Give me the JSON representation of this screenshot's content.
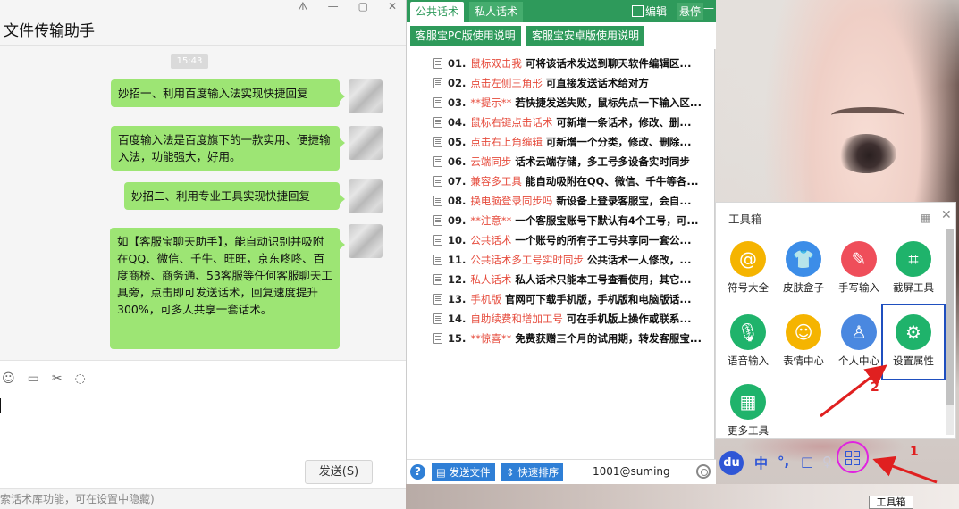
{
  "chat": {
    "title": "文件传输助手",
    "window_controls": [
      "ᗑ",
      "—",
      "▢",
      "✕"
    ],
    "time": "15:43",
    "messages": [
      "妙招一、利用百度输入法实现快捷回复",
      "百度输入法是百度旗下的一款实用、便捷输入法，功能强大，好用。",
      "妙招二、利用专业工具实现快捷回复",
      "如【客服宝聊天助手】，能自动识别并吸附在QQ、微信、千牛、旺旺，京东咚咚、百度商桥、商务通、53客服等任何客服聊天工具旁，点击即可发送话术，回复速度提升300%，可多人共享一套话术。"
    ],
    "input_icons": [
      "emoji-icon",
      "folder-icon",
      "scissors-icon",
      "chat-history-icon"
    ],
    "input_icon_glyphs": [
      "☺",
      "▭",
      "✂",
      "◌"
    ],
    "send_label": "发送(S)",
    "status_line": "索话术库功能，可在设置中隐藏)"
  },
  "panel": {
    "tabs": [
      "公共话术",
      "私人话术"
    ],
    "edit_label": "编辑",
    "pin_label": "悬停",
    "minimize_label": "—",
    "sub_tabs": [
      "客服宝PC版使用说明",
      "客服宝安卓版使用说明"
    ],
    "items": [
      {
        "num": "01.",
        "hl": "鼠标双击我",
        "text": "可将该话术发送到聊天软件编辑区..."
      },
      {
        "num": "02.",
        "hl": "点击左侧三角形",
        "text": "可直接发送话术给对方"
      },
      {
        "num": "03.",
        "hl": "**提示**",
        "text": "若快捷发送失败，鼠标先点一下输入区..."
      },
      {
        "num": "04.",
        "hl": "鼠标右键点击话术",
        "text": "可新增一条话术，修改、删..."
      },
      {
        "num": "05.",
        "hl": "点击右上角编辑",
        "text": "可新增一个分类，修改、删除..."
      },
      {
        "num": "06.",
        "hl": "云端同步",
        "text": "话术云端存储，多工号多设备实时同步"
      },
      {
        "num": "07.",
        "hl": "兼容多工具",
        "text": "能自动吸附在QQ、微信、千牛等各..."
      },
      {
        "num": "08.",
        "hl": "换电脑登录同步吗",
        "text": "新设备上登录客服宝，会自..."
      },
      {
        "num": "09.",
        "hl": "**注意**",
        "text": "一个客服宝账号下默认有4个工号，可..."
      },
      {
        "num": "10.",
        "hl": "公共话术",
        "text": "一个账号的所有子工号共享同一套公..."
      },
      {
        "num": "11.",
        "hl": "公共话术多工号实时同步",
        "text": "公共话术一人修改，..."
      },
      {
        "num": "12.",
        "hl": "私人话术",
        "text": "私人话术只能本工号查看使用，其它..."
      },
      {
        "num": "13.",
        "hl": "手机版",
        "text": "官网可下载手机版，手机版和电脑版话..."
      },
      {
        "num": "14.",
        "hl": "自助续费和增加工号",
        "text": "可在手机版上操作或联系..."
      },
      {
        "num": "15.",
        "hl": "**惊喜**",
        "text": "免费获赠三个月的试用期，转发客服宝..."
      }
    ],
    "help_label": "?",
    "send_file_label": "发送文件",
    "sort_label": "快速排序",
    "account": "1001@suming"
  },
  "toolbox": {
    "title": "工具箱",
    "tools": [
      {
        "label": "符号大全",
        "icon": "at-icon",
        "glyph": "@",
        "color": "#f5b400"
      },
      {
        "label": "皮肤盒子",
        "icon": "shirt-icon",
        "glyph": "👕",
        "color": "#3c8de8"
      },
      {
        "label": "手写输入",
        "icon": "pen-icon",
        "glyph": "✎",
        "color": "#ef4e5a"
      },
      {
        "label": "截屏工具",
        "icon": "crop-icon",
        "glyph": "⌗",
        "color": "#1fb36b"
      },
      {
        "label": "语音输入",
        "icon": "microphone-icon",
        "glyph": "🎙",
        "color": "#1fb36b"
      },
      {
        "label": "表情中心",
        "icon": "smiley-icon",
        "glyph": "☺",
        "color": "#f5b400"
      },
      {
        "label": "个人中心",
        "icon": "user-icon",
        "glyph": "♙",
        "color": "#4a88e0"
      },
      {
        "label": "设置属性",
        "icon": "gear-icon",
        "glyph": "⚙",
        "color": "#1fb36b"
      },
      {
        "label": "更多工具",
        "icon": "grid-icon",
        "glyph": "▦",
        "color": "#1fb36b"
      }
    ]
  },
  "ime": {
    "logo": "du",
    "items": [
      "中",
      "°,",
      "□",
      "♀"
    ],
    "tooltip": "工具箱"
  },
  "annotations": [
    "1",
    "2"
  ]
}
